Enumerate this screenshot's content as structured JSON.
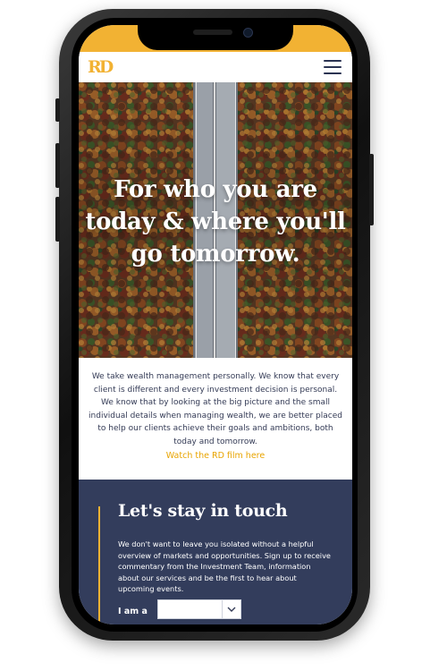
{
  "colors": {
    "accent": "#f2b233",
    "navy": "#333d5c",
    "link": "#e8a400",
    "hero_text": "#ffffff"
  },
  "header": {
    "logo": "RD",
    "menu_icon": "hamburger-menu-icon"
  },
  "hero": {
    "title": "For who you are today & where you'll go tomorrow."
  },
  "intro": {
    "text": "We take wealth management personally. We know that every client is different and every investment decision is personal. We know that by looking at the big picture and the small individual details when managing wealth, we are better placed to help our clients achieve their goals and ambitions, both today and tomorrow.",
    "film_link": "Watch the RD film here"
  },
  "contact": {
    "title": "Let's stay in touch",
    "text": "We don't want to leave you isolated without a helpful overview of markets and opportunities. Sign up to receive commentary from the Investment Team, information about our services and be the first to hear about upcoming events.",
    "iam_label": "I am a",
    "iam_value": "",
    "chevron_icon": "chevron-down-icon"
  }
}
